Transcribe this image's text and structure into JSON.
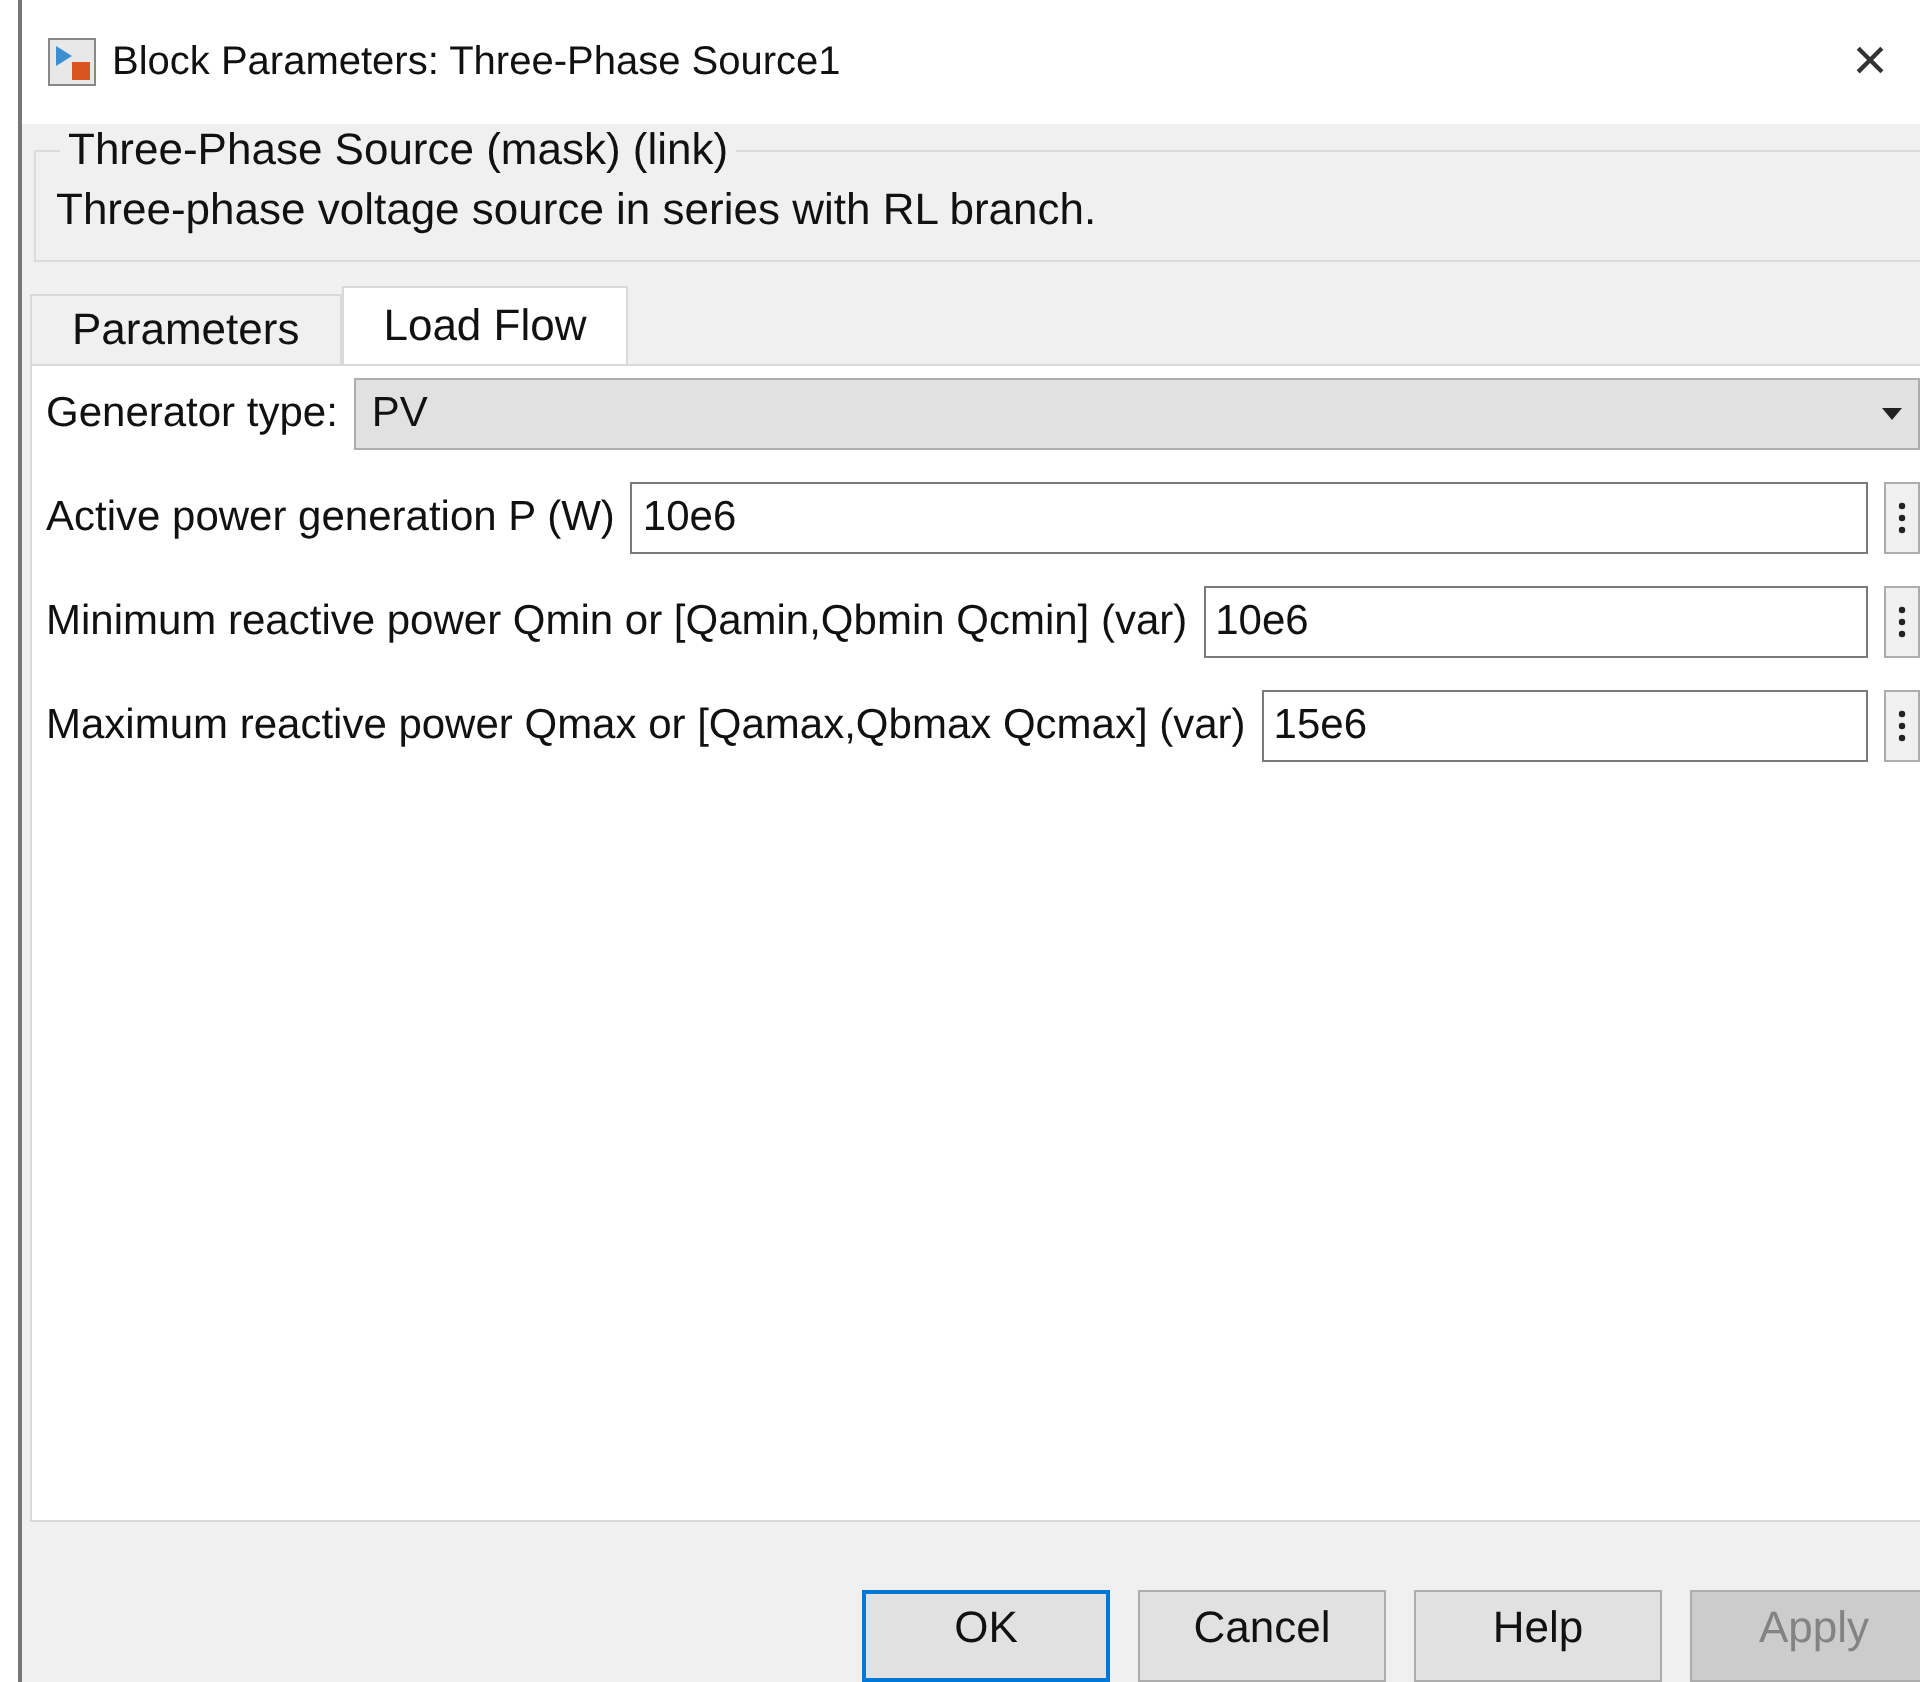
{
  "window": {
    "title": "Block Parameters: Three-Phase Source1",
    "close": "×"
  },
  "group": {
    "title": "Three-Phase Source (mask) (link)",
    "description": "Three-phase voltage source in series with RL branch."
  },
  "tabs": [
    {
      "label": "Parameters",
      "selected": false
    },
    {
      "label": "Load Flow",
      "selected": true
    }
  ],
  "generator_type": {
    "label": "Generator type:",
    "value": "PV"
  },
  "parameters": [
    {
      "label": "Active power generation P (W)",
      "value": "10e6"
    },
    {
      "label": "Minimum reactive power Qmin or [Qamin,Qbmin Qcmin] (var)",
      "value": "10e6"
    },
    {
      "label": "Maximum reactive power Qmax or [Qamax,Qbmax Qcmax] (var)",
      "value": "15e6"
    }
  ],
  "buttons": [
    {
      "label": "OK",
      "focused": true,
      "disabled": false
    },
    {
      "label": "Cancel",
      "focused": false,
      "disabled": false
    },
    {
      "label": "Help",
      "focused": false,
      "disabled": false
    },
    {
      "label": "Apply",
      "focused": false,
      "disabled": true
    }
  ]
}
